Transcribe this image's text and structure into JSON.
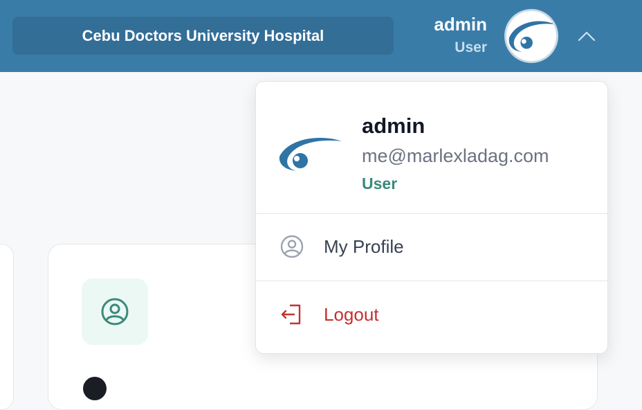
{
  "header": {
    "hospital_name": "Cebu Doctors University Hospital",
    "user_name": "admin",
    "user_role": "User"
  },
  "dropdown": {
    "name": "admin",
    "email": "me@marlexladag.com",
    "role": "User",
    "items": [
      {
        "label": "My Profile",
        "icon": "user-circle-icon"
      },
      {
        "label": "Logout",
        "icon": "logout-icon"
      }
    ]
  },
  "colors": {
    "header_bg": "#3a7ca8",
    "accent_green": "#3a8a7a",
    "logout_red": "#c53030"
  }
}
